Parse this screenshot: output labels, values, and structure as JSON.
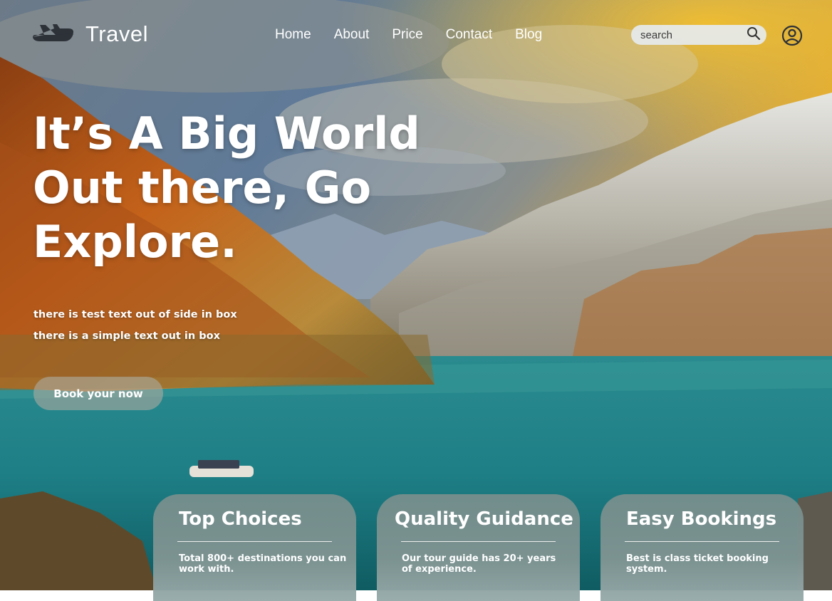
{
  "brand": {
    "name": "Travel",
    "logo_icon": "airplane-icon"
  },
  "nav": {
    "items": [
      "Home",
      "About",
      "Price",
      "Contact",
      "Blog"
    ]
  },
  "search": {
    "placeholder": "search",
    "icon": "search-icon"
  },
  "account": {
    "icon": "user-circle-icon"
  },
  "hero": {
    "title_lines": [
      "It’s A Big World",
      "Out there, Go",
      "Explore."
    ],
    "subtitle_lines": [
      "there is test text out of side in box",
      "there is a simple text out in box"
    ],
    "cta_label": "Book your now"
  },
  "features": [
    {
      "title": "Top Choices",
      "text": "Total 800+ destinations you can work with."
    },
    {
      "title": "Quality Guidance",
      "text": "Our tour guide has 20+ years of experience."
    },
    {
      "title": "Easy Bookings",
      "text": "Best is class ticket booking system."
    }
  ],
  "colors": {
    "sky_gold": "#f2b320",
    "sky_blue": "#5f7a98",
    "lake_teal": "#1e7f86",
    "mountain_orange": "#c4621a",
    "snow": "#e6e6e2"
  }
}
